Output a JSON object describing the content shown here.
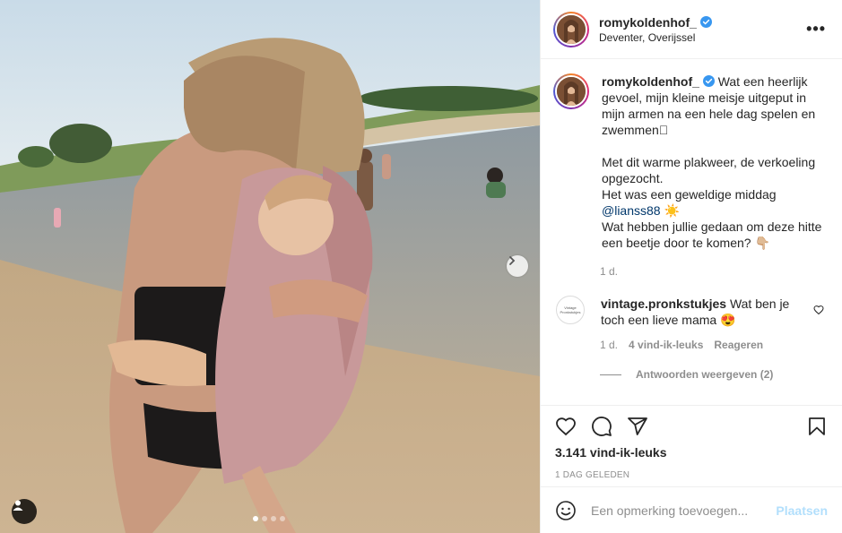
{
  "post": {
    "username": "romykoldenhof_",
    "location": "Deventer, Overijssel",
    "more_label": "•••",
    "caption": {
      "line1": "Wat een heerlijk gevoel, mijn kleine meisje uitgeput in mijn armen na een hele dag spelen en zwemmen🏽",
      "line2": "Met dit warme plakweer, de verkoeling opgezocht.",
      "line3": "Het was een geweldige middag",
      "mention": "@lianss88",
      "mention_suffix": " ☀️",
      "line4": "Wat hebben jullie gedaan om deze hitte een beetje door te komen? 👇🏼"
    },
    "caption_time": "1 d.",
    "carousel": {
      "slides": 4,
      "active": 1
    },
    "likes": "3.141 vind-ik-leuks",
    "date": "1 DAG GELEDEN"
  },
  "comment": {
    "username": "vintage.pronkstukjes",
    "avatar_text": "Vintage Pronkstukjes",
    "text": "Wat ben je toch een lieve mama 😍",
    "time": "1 d.",
    "likes": "4 vind-ik-leuks",
    "reply_label": "Reageren",
    "view_replies": "Antwoorden weergeven (2)"
  },
  "add_comment": {
    "placeholder": "Een opmerking toevoegen...",
    "post_label": "Plaatsen"
  },
  "icons": {
    "verified": "verified-badge-icon",
    "like": "heart-icon",
    "comment": "comment-icon",
    "share": "send-icon",
    "save": "bookmark-icon",
    "emoji": "emoji-icon",
    "next": "chevron-right-icon",
    "tag": "user-tag-icon"
  },
  "colors": {
    "verified": "#3897f0",
    "link": "#00376b",
    "post_btn_disabled": "#b2dffc"
  }
}
